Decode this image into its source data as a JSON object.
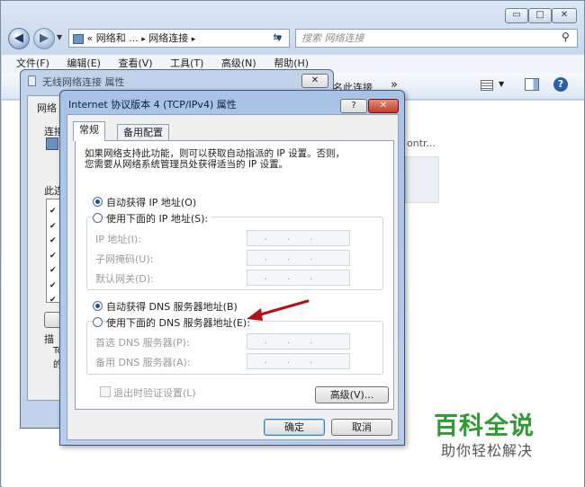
{
  "explorer": {
    "address": [
      "«",
      "网络和 ...",
      "▸",
      "网络连接",
      "▸"
    ],
    "search_placeholder": "搜索 网络连接",
    "menu": [
      "文件(F)",
      "编辑(E)",
      "查看(V)",
      "工具(T)",
      "高级(N)",
      "帮助(H)"
    ],
    "cmd_more": "名此连接",
    "cmd_chevron": "»",
    "content_snippet": "ontr...",
    "min_label": "▭",
    "max_label": "□",
    "close_label": "✕"
  },
  "wireless_dialog": {
    "title": "无线网络连接 属性",
    "tab": "网络",
    "connect_label": "连接",
    "items_label": "此连",
    "desc_label": "描",
    "desc_lines": [
      "Tc",
      "的"
    ]
  },
  "ipv4_dialog": {
    "title": "Internet 协议版本 4 (TCP/IPv4) 属性",
    "help_label": "?",
    "close_label": "✕",
    "tabs": [
      "常规",
      "备用配置"
    ],
    "intro": [
      "如果网络支持此功能，则可以获取自动指派的 IP 设置。否则，",
      "您需要从网络系统管理员处获得适当的 IP 设置。"
    ],
    "auto_ip": "自动获得 IP 地址(O)",
    "manual_ip": "使用下面的 IP 地址(S):",
    "ip_fields": [
      "IP 地址(I):",
      "子网掩码(U):",
      "默认网关(D):"
    ],
    "auto_dns": "自动获得 DNS 服务器地址(B)",
    "manual_dns": "使用下面的 DNS 服务器地址(E):",
    "dns_fields": [
      "首选 DNS 服务器(P):",
      "备用 DNS 服务器(A):"
    ],
    "field_dots": "...",
    "validate": "退出时验证设置(L)",
    "advanced": "高级(V)...",
    "ok": "确定",
    "cancel": "取消"
  },
  "watermark": {
    "title": "百科全说",
    "subtitle": "助你轻松解决"
  },
  "colors": {
    "arrow": "#b3121b",
    "watermark_green": "#2e9b35"
  }
}
